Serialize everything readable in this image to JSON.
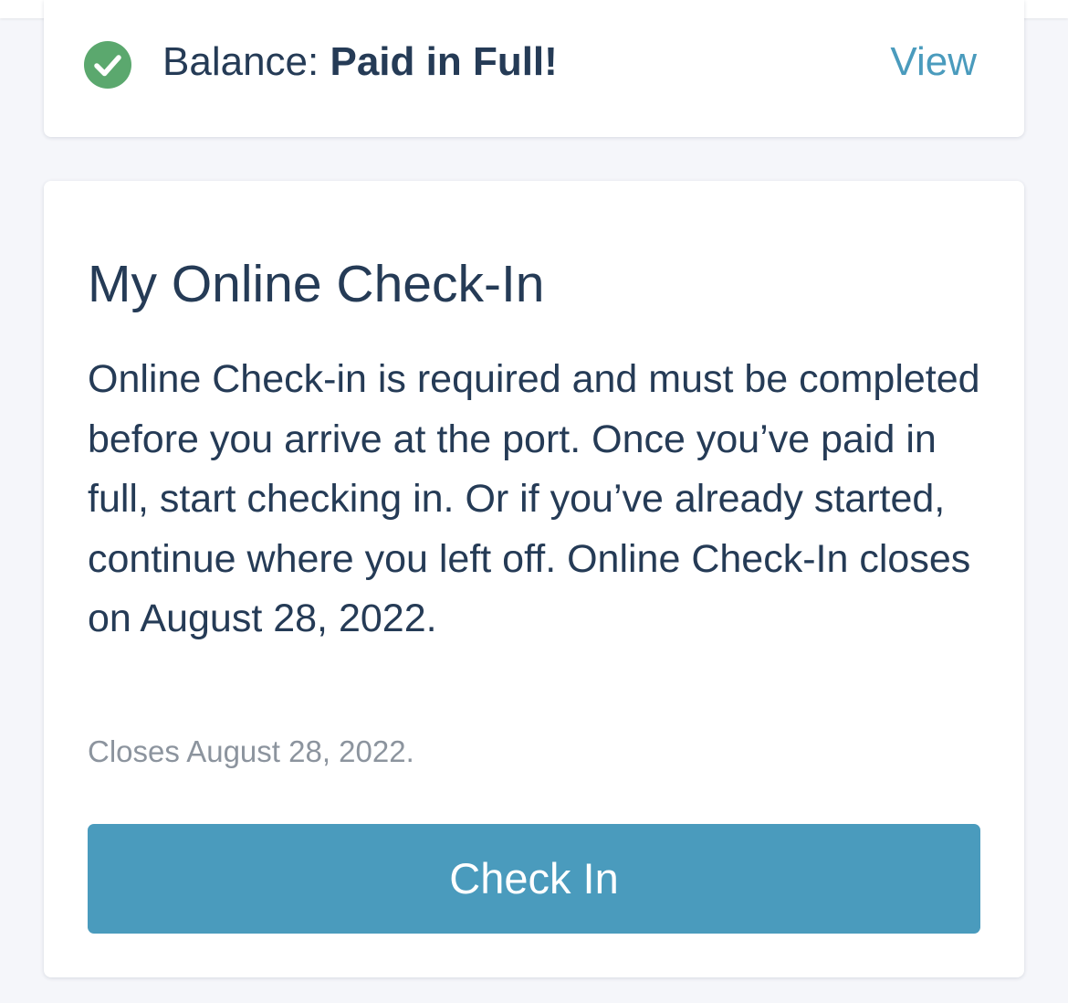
{
  "balance": {
    "label": "Balance: ",
    "status": "Paid in Full!",
    "icon": "check-circle-icon",
    "link_label": "View"
  },
  "checkin": {
    "title": "My Online Check-In",
    "description": "Online Check-in is required and must be completed before you arrive at the port. Once you’ve paid in full, start checking in. Or if you’ve already started, continue where you left off. Online Check-In closes on August 28, 2022.",
    "closes_note": "Closes August 28, 2022.",
    "button_label": "Check In"
  },
  "colors": {
    "accent": "#4a9bbd",
    "success": "#5ba86e",
    "text": "#253b56",
    "muted": "#8c949e",
    "background": "#f5f6fa"
  }
}
